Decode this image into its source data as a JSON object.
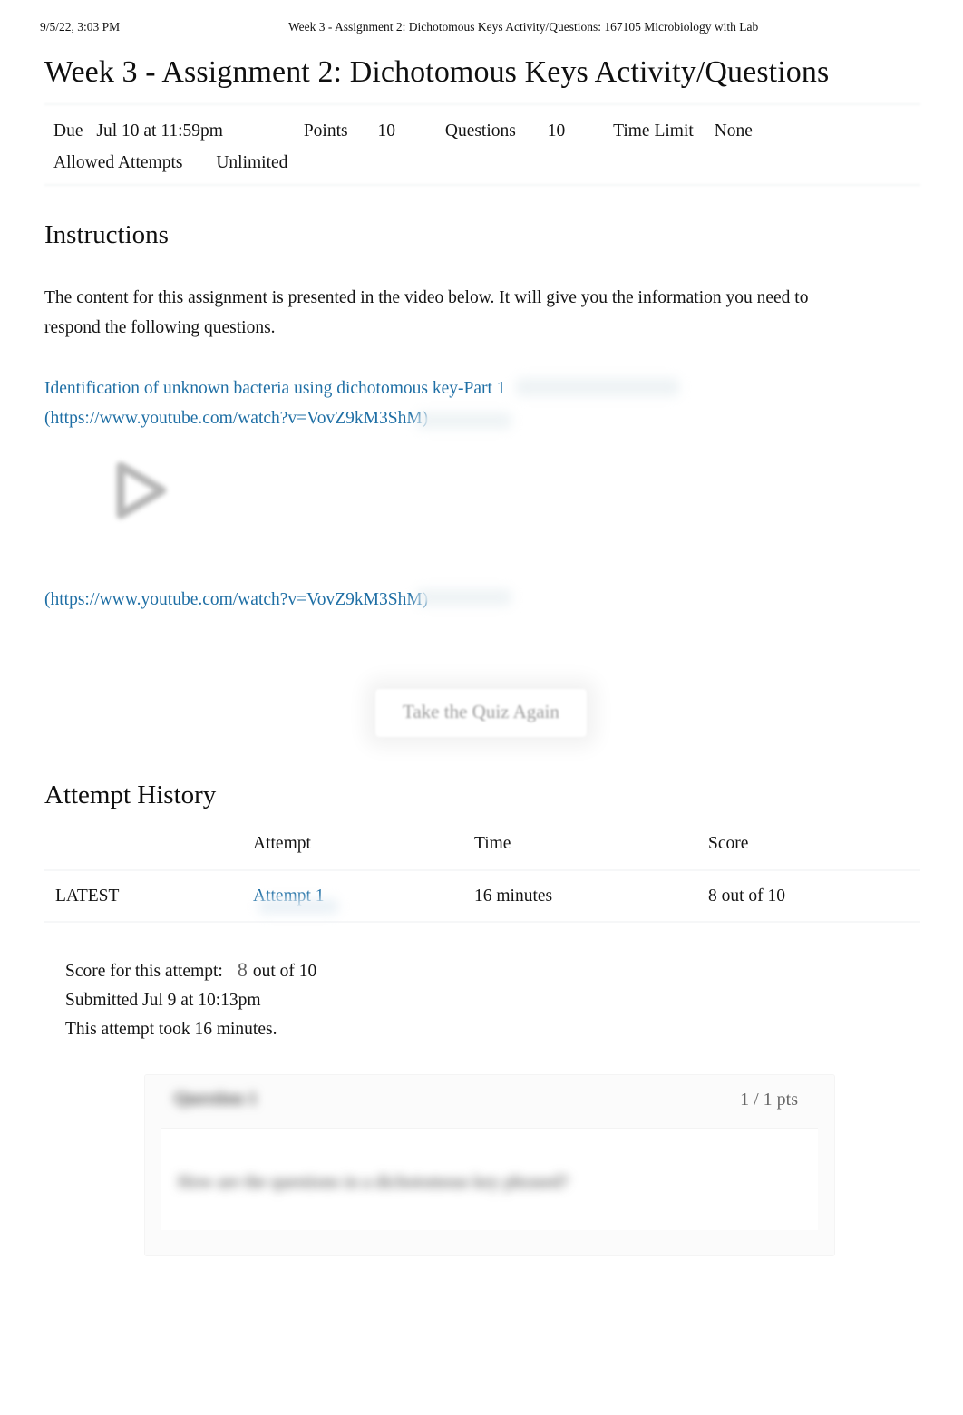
{
  "print_header": {
    "date": "9/5/22, 3:03 PM",
    "title": "Week 3 - Assignment 2: Dichotomous Keys Activity/Questions: 167105 Microbiology with Lab"
  },
  "quiz": {
    "title": "Week 3 - Assignment 2: Dichotomous Keys Activity/Questions",
    "meta": {
      "due_label": "Due",
      "due_value": "Jul 10 at 11:59pm",
      "points_label": "Points",
      "points_value": "10",
      "questions_label": "Questions",
      "questions_value": "10",
      "time_limit_label": "Time Limit",
      "time_limit_value": "None",
      "allowed_attempts_label": "Allowed Attempts",
      "allowed_attempts_value": "Unlimited"
    }
  },
  "instructions": {
    "heading": "Instructions",
    "paragraph": "The content for this assignment is presented in the video below. It will give you the information you need to respond the following questions.",
    "video_link_text": "Identification of unknown bacteria using dichotomous key-Part 1",
    "video_url_text": "(https://www.youtube.com/watch?v=VovZ9kM3ShM)",
    "video_url_text_repeat": "(https://www.youtube.com/watch?v=VovZ9kM3ShM)",
    "play_icon": "play-icon"
  },
  "actions": {
    "take_quiz_again": "Take the Quiz Again"
  },
  "attempt_history": {
    "heading": "Attempt History",
    "columns": [
      "",
      "Attempt",
      "Time",
      "Score"
    ],
    "rows": [
      {
        "kept": "LATEST",
        "attempt": "Attempt 1",
        "time": "16 minutes",
        "score": "8 out of 10"
      }
    ]
  },
  "score_summary": {
    "score_label": "Score for this attempt:",
    "score_value": "8",
    "score_out_of": "out of 10",
    "submitted": "Submitted Jul 9 at 10:13pm",
    "duration": "This attempt took 16 minutes."
  },
  "question": {
    "title": "Question 1",
    "points": "1 / 1 pts",
    "text": "How are the questions in a dichotomous key phrased?"
  },
  "colors": {
    "link": "#1f6fa5",
    "text": "#141414",
    "muted": "#676767",
    "button_text": "#9c9c9c",
    "divider": "#f6f7f8"
  }
}
